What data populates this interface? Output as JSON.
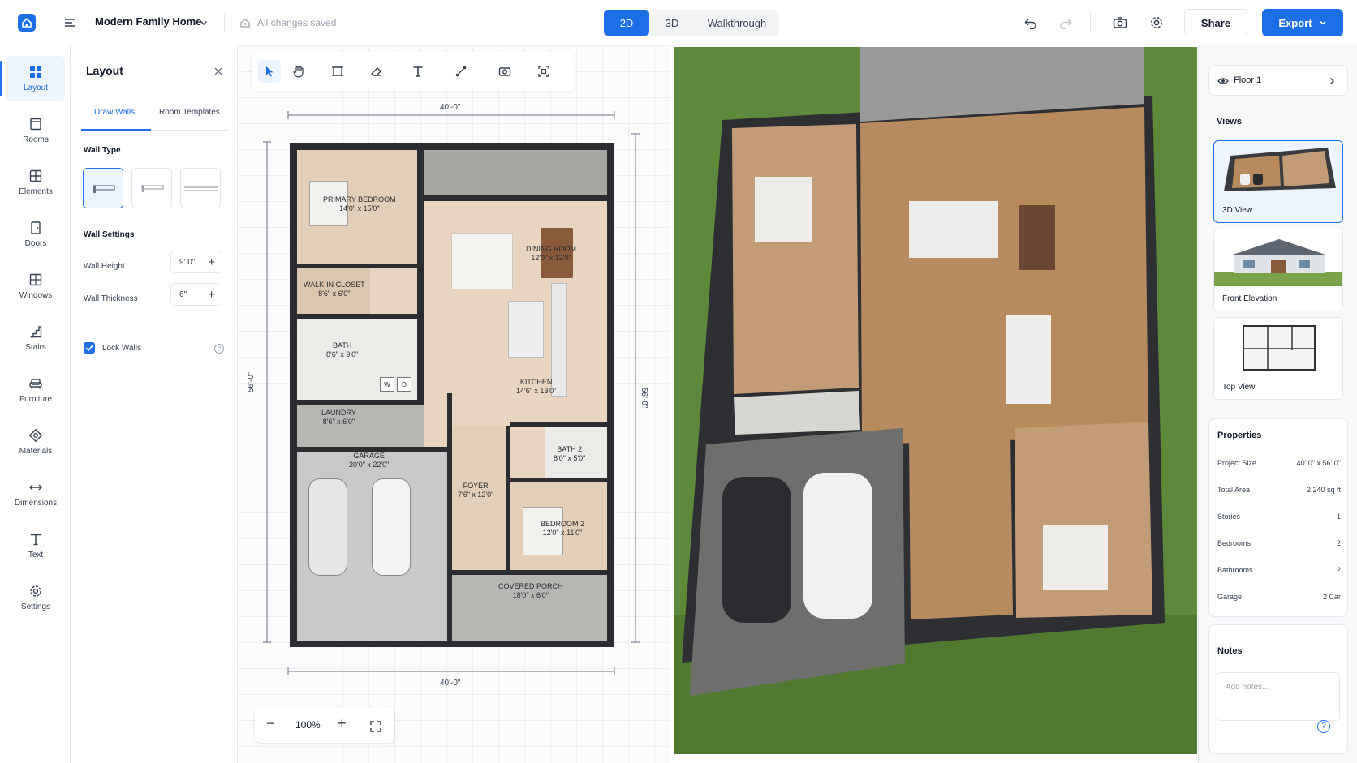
{
  "header": {
    "project_name": "Modern Family Home",
    "save_status": "All changes saved",
    "modes": [
      "2D",
      "3D",
      "Walkthrough"
    ],
    "active_mode": "2D",
    "share_label": "Share",
    "export_label": "Export"
  },
  "rail": {
    "items": [
      {
        "label": "Layout",
        "icon": "grid-icon",
        "active": true
      },
      {
        "label": "Rooms",
        "icon": "room-icon"
      },
      {
        "label": "Elements",
        "icon": "elements-icon"
      },
      {
        "label": "Doors",
        "icon": "door-icon"
      },
      {
        "label": "Windows",
        "icon": "window-icon"
      },
      {
        "label": "Stairs",
        "icon": "stairs-icon"
      },
      {
        "label": "Furniture",
        "icon": "sofa-icon"
      },
      {
        "label": "Materials",
        "icon": "material-icon"
      },
      {
        "label": "Dimensions",
        "icon": "dimension-icon"
      },
      {
        "label": "Text",
        "icon": "text-icon"
      },
      {
        "label": "Settings",
        "icon": "gear-icon"
      }
    ]
  },
  "panel": {
    "title": "Layout",
    "tabs": [
      "Draw Walls",
      "Room Templates"
    ],
    "wall_type_heading": "Wall Type",
    "wall_settings_heading": "Wall Settings",
    "wall_height_label": "Wall Height",
    "wall_height_value": "9' 0\"",
    "wall_thickness_label": "Wall Thickness",
    "wall_thickness_value": "6\"",
    "lock_walls_label": "Lock Walls",
    "lock_walls_checked": true
  },
  "canvas": {
    "dim_top": "40'-0\"",
    "dim_bottom": "40'-0\"",
    "dim_left": "56'-0\"",
    "dim_right": "56'-0\"",
    "zoom": "100%",
    "rooms": [
      {
        "name": "PRIMARY BEDROOM",
        "size": "14'0\" x 15'0\""
      },
      {
        "name": "DINING ROOM",
        "size": "12'0\" x 12'0\""
      },
      {
        "name": "WALK-IN CLOSET",
        "size": "8'6\" x 6'0\""
      },
      {
        "name": "BATH",
        "size": "8'6\" x 9'0\""
      },
      {
        "name": "KITCHEN",
        "size": "14'6\" x 13'0\""
      },
      {
        "name": "LAUNDRY",
        "size": "8'6\" x 6'0\""
      },
      {
        "name": "GARAGE",
        "size": "20'0\" x 22'0\""
      },
      {
        "name": "BATH 2",
        "size": "8'0\" x 5'0\""
      },
      {
        "name": "FOYER",
        "size": "7'6\" x 12'0\""
      },
      {
        "name": "BEDROOM 2",
        "size": "12'0\" x 11'0\""
      },
      {
        "name": "COVERED PORCH",
        "size": "18'0\" x 6'0\""
      }
    ],
    "appliance_labels": [
      "W",
      "D"
    ]
  },
  "right": {
    "floor_label": "Floor 1",
    "views_heading": "Views",
    "views": [
      "3D View",
      "Front Elevation",
      "Top View"
    ],
    "properties_heading": "Properties",
    "properties": [
      {
        "k": "Project Size",
        "v": "40' 0\" x 56' 0\""
      },
      {
        "k": "Total Area",
        "v": "2,240 sq ft"
      },
      {
        "k": "Stories",
        "v": "1"
      },
      {
        "k": "Bedrooms",
        "v": "2"
      },
      {
        "k": "Bathrooms",
        "v": "2"
      },
      {
        "k": "Garage",
        "v": "2 Car"
      }
    ],
    "notes_heading": "Notes",
    "notes_placeholder": "Add notes..."
  },
  "colors": {
    "accent": "#1d6fe8",
    "wall": "#2c2d30",
    "floor_wood": "#e3cfb8",
    "garage": "#c9c9c9",
    "grass": "#5d8a3a"
  }
}
